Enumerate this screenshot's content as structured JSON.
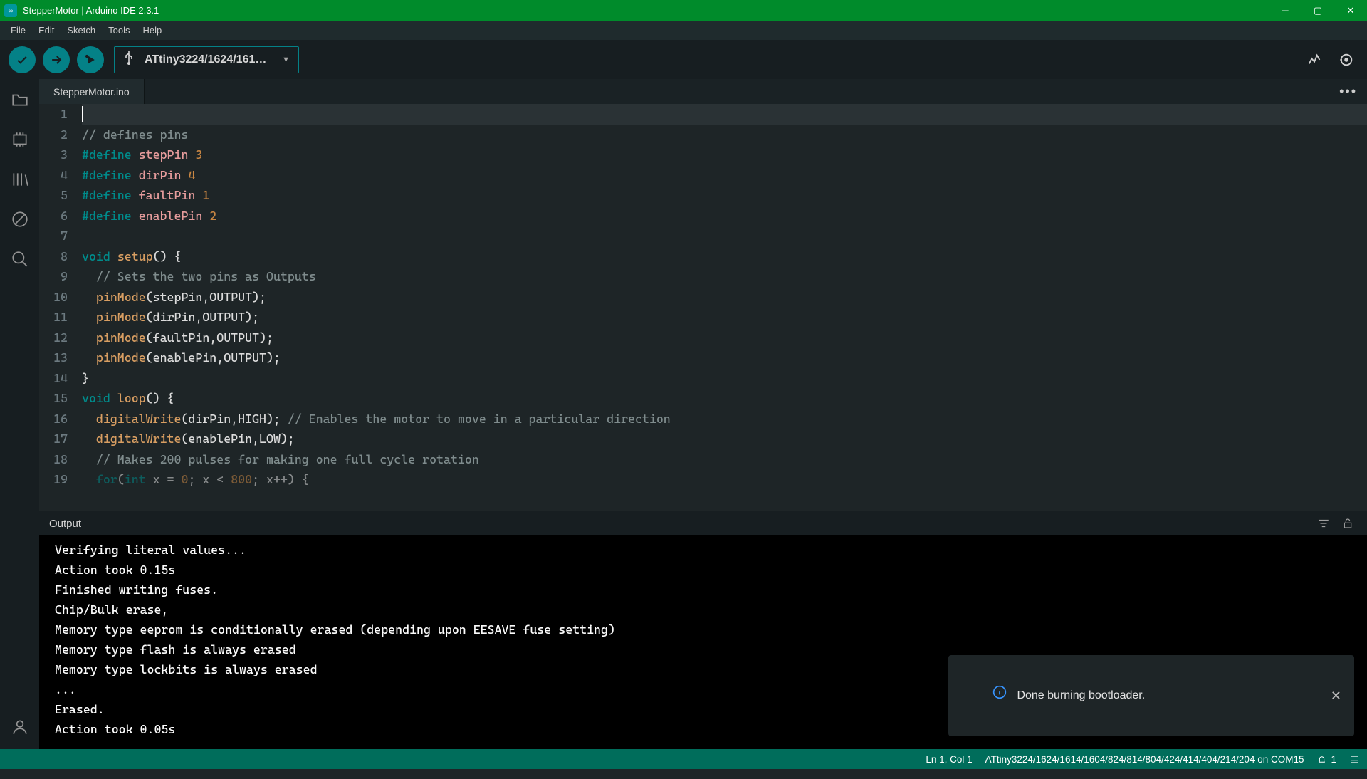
{
  "window": {
    "title": "StepperMotor | Arduino IDE 2.3.1"
  },
  "menubar": [
    "File",
    "Edit",
    "Sketch",
    "Tools",
    "Help"
  ],
  "toolbar": {
    "board_label": "ATtiny3224/1624/161…"
  },
  "tab": {
    "name": "StepperMotor.ino"
  },
  "code": {
    "l1": "",
    "l2_comment": "// defines pins",
    "l3_def": "#define",
    "l3_name": "stepPin",
    "l3_val": "3",
    "l4_def": "#define",
    "l4_name": "dirPin",
    "l4_val": "4",
    "l5_def": "#define",
    "l5_name": "faultPin",
    "l5_val": "1",
    "l6_def": "#define",
    "l6_name": "enablePin",
    "l6_val": "2",
    "l8_void": "void",
    "l8_name": "setup",
    "l8_rest": "() {",
    "l9_comment": "// Sets the two pins as Outputs",
    "l10_fn": "pinMode",
    "l10_args": "(stepPin,OUTPUT);",
    "l11_fn": "pinMode",
    "l11_args": "(dirPin,OUTPUT);",
    "l12_fn": "pinMode",
    "l12_args": "(faultPin,OUTPUT);",
    "l13_fn": "pinMode",
    "l13_args": "(enablePin,OUTPUT);",
    "l14": "}",
    "l15_void": "void",
    "l15_name": "loop",
    "l15_rest": "() {",
    "l16_fn": "digitalWrite",
    "l16_args": "(dirPin,HIGH); ",
    "l16_comment": "// Enables the motor to move in a particular direction",
    "l17_fn": "digitalWrite",
    "l17_args": "(enablePin,LOW);",
    "l18_comment": "// Makes 200 pulses for making one full cycle rotation",
    "l19_for": "for",
    "l19_int": "int",
    "l19_rest_a": "(",
    "l19_rest_b": " x = ",
    "l19_zero": "0",
    "l19_rest_c": "; x < ",
    "l19_num": "800",
    "l19_rest_d": "; x++) {"
  },
  "gutter": [
    "1",
    "2",
    "3",
    "4",
    "5",
    "6",
    "7",
    "8",
    "9",
    "10",
    "11",
    "12",
    "13",
    "14",
    "15",
    "16",
    "17",
    "18",
    "19"
  ],
  "output": {
    "title": "Output",
    "lines": "Verifying literal values...\nAction took 0.15s\nFinished writing fuses.\nChip/Bulk erase,\nMemory type eeprom is conditionally erased (depending upon EESAVE fuse setting)\nMemory type flash is always erased\nMemory type lockbits is always erased\n...\nErased.\nAction took 0.05s"
  },
  "toast": {
    "text": "Done burning bootloader."
  },
  "statusbar": {
    "cursor": "Ln 1, Col 1",
    "board": "ATtiny3224/1624/1614/1604/824/814/804/424/414/404/214/204 on COM15",
    "notif_count": "1"
  }
}
